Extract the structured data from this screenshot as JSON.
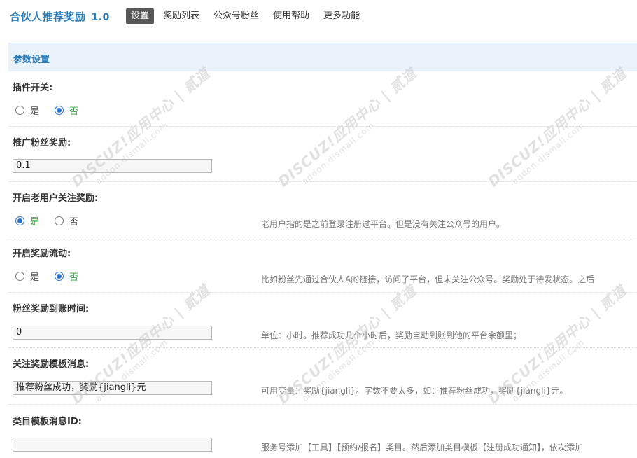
{
  "header": {
    "app_name": "合伙人推荐奖励",
    "version": "1.0",
    "tabs": [
      {
        "label": "设置",
        "active": true
      },
      {
        "label": "奖励列表",
        "active": false
      },
      {
        "label": "公众号粉丝",
        "active": false
      },
      {
        "label": "使用帮助",
        "active": false
      },
      {
        "label": "更多功能",
        "active": false
      }
    ]
  },
  "section": {
    "title": "参数设置"
  },
  "settings": {
    "plugin_switch": {
      "label": "插件开关:",
      "options": [
        "是",
        "否"
      ],
      "selected": "否"
    },
    "promo_reward": {
      "label": "推广粉丝奖励:",
      "value": "0.1"
    },
    "old_user_reward": {
      "label": "开启老用户关注奖励:",
      "options": [
        "是",
        "否"
      ],
      "selected": "是",
      "description": "老用户指的是之前登录注册过平台。但是没有关注公众号的用户。"
    },
    "reward_flow": {
      "label": "开启奖励流动:",
      "options": [
        "是",
        "否"
      ],
      "selected": "否",
      "description": "比如粉丝先通过合伙人A的链接，访问了平台，但未关注公众号。奖励处于待发状态。之后"
    },
    "arrival_time": {
      "label": "粉丝奖励到账时间:",
      "value": "0",
      "description": "单位：小时。推荐成功几个小时后，奖励自动到账到他的平台余额里；"
    },
    "follow_template": {
      "label": "关注奖励模板消息:",
      "value": "推荐粉丝成功，奖励{jiangli}元",
      "description": "可用变量：奖励{jiangli}。字数不要太多，如：推荐粉丝成功，奖励{jiangli}元。"
    },
    "category_template": {
      "label": "类目模板消息ID:",
      "value": "",
      "description": "服务号添加【工具】【预约/报名】类目。然后添加类目模板【注册成功通知】，依次添加"
    }
  },
  "watermark": {
    "main": "DISCUZ!应用中心 | 贰道",
    "sub": "addon.dismall.com"
  },
  "colors": {
    "accent": "#2b7dbc",
    "section_bg": "#eaf3fb",
    "active_tab_bg": "#585858",
    "radio_checked": "#2a74d6",
    "selected_label": "#3ba53b"
  }
}
